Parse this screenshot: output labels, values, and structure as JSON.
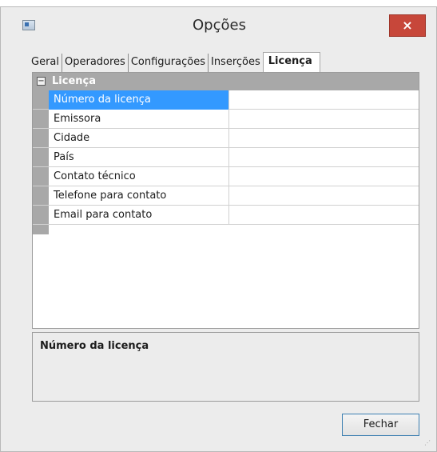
{
  "window": {
    "title": "Opções",
    "close_label": "×"
  },
  "tabs": [
    {
      "label": "Geral",
      "active": false
    },
    {
      "label": "Operadores",
      "active": false
    },
    {
      "label": "Configurações",
      "active": false
    },
    {
      "label": "Inserções",
      "active": false
    },
    {
      "label": "Licença",
      "active": true
    }
  ],
  "property_grid": {
    "category": {
      "label": "Licença",
      "expanded": true,
      "toggle_glyph": "−"
    },
    "rows": [
      {
        "name": "Número da licença",
        "value": "",
        "selected": true
      },
      {
        "name": "Emissora",
        "value": "",
        "selected": false
      },
      {
        "name": "Cidade",
        "value": "",
        "selected": false
      },
      {
        "name": "País",
        "value": "",
        "selected": false
      },
      {
        "name": "Contato técnico",
        "value": "",
        "selected": false
      },
      {
        "name": "Telefone para contato",
        "value": "",
        "selected": false
      },
      {
        "name": "Email para contato",
        "value": "",
        "selected": false
      }
    ]
  },
  "description": {
    "title": "Número da licença"
  },
  "footer": {
    "close_button": "Fechar"
  },
  "colors": {
    "selection": "#3399ff",
    "category_bar": "#a8a8a8",
    "close_button": "#c7473a"
  }
}
